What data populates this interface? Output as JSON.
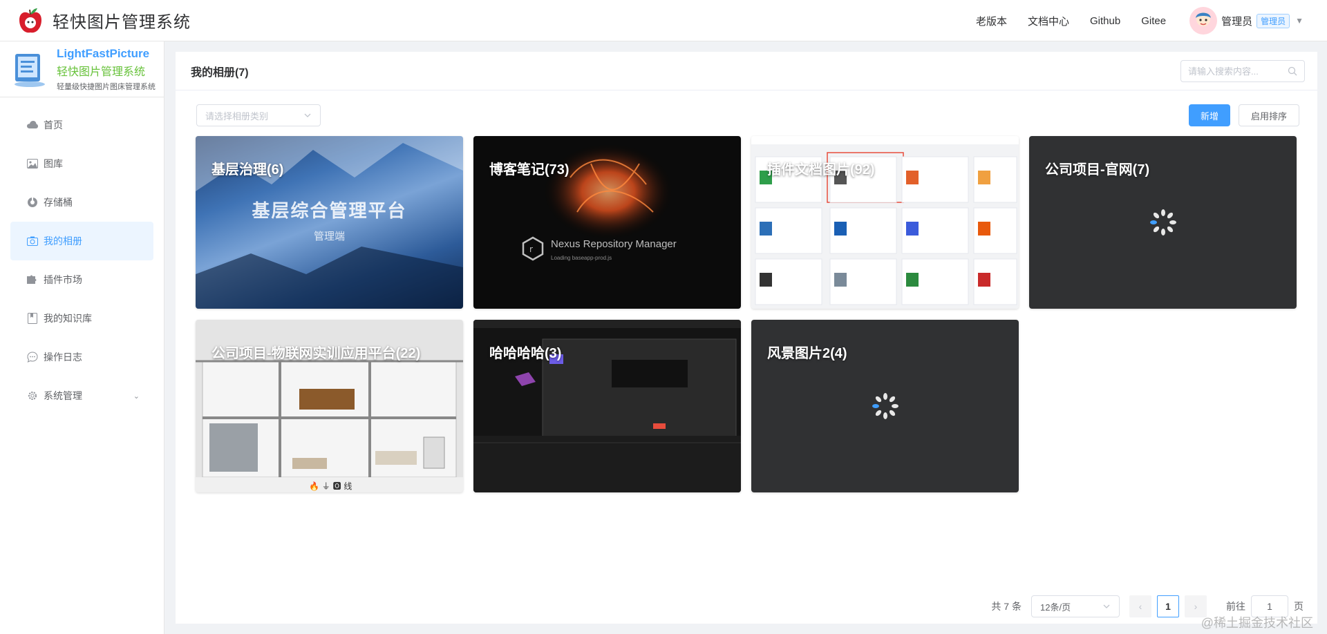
{
  "header": {
    "app_title": "轻快图片管理系统",
    "nav": [
      "老版本",
      "文档中心",
      "Github",
      "Gitee"
    ],
    "user_name": "管理员",
    "role_badge": "管理员"
  },
  "brand": {
    "name": "LightFastPicture",
    "subtitle": "轻快图片管理系统",
    "description": "轻量级快捷图片图床管理系统"
  },
  "sidebar": {
    "items": [
      {
        "label": "首页",
        "icon": "cloud-icon"
      },
      {
        "label": "图库",
        "icon": "image-icon"
      },
      {
        "label": "存储桶",
        "icon": "bucket-icon"
      },
      {
        "label": "我的相册",
        "icon": "camera-icon",
        "active": true
      },
      {
        "label": "插件市场",
        "icon": "puzzle-icon"
      },
      {
        "label": "我的知识库",
        "icon": "book-icon"
      },
      {
        "label": "操作日志",
        "icon": "chat-icon"
      },
      {
        "label": "系统管理",
        "icon": "gear-icon"
      }
    ]
  },
  "main": {
    "title": "我的相册(7)",
    "search_placeholder": "请输入搜索内容...",
    "category_placeholder": "请选择相册类别",
    "add_label": "新增",
    "sort_label": "启用排序"
  },
  "albums": [
    {
      "title": "基层治理(6)",
      "bg_title": "基层综合管理平台",
      "bg_sub": "管理端"
    },
    {
      "title": "博客笔记(73)",
      "bg_title": "Nexus Repository Manager",
      "bg_sub": "Loading baseapp-prod.js"
    },
    {
      "title": "插件文档图片(92)"
    },
    {
      "title": "公司项目-官网(7)"
    },
    {
      "title": "公司项目-物联网实训应用平台(22)"
    },
    {
      "title": "哈哈哈哈(3)"
    },
    {
      "title": "风景图片2(4)"
    }
  ],
  "pagination": {
    "total": "共 7 条",
    "page_size": "12条/页",
    "current": "1",
    "goto_label": "前往",
    "goto_value": "1",
    "page_unit": "页"
  },
  "watermark": "@稀土掘金技术社区",
  "colors": {
    "primary": "#409eff",
    "brand_green": "#67c23a"
  }
}
